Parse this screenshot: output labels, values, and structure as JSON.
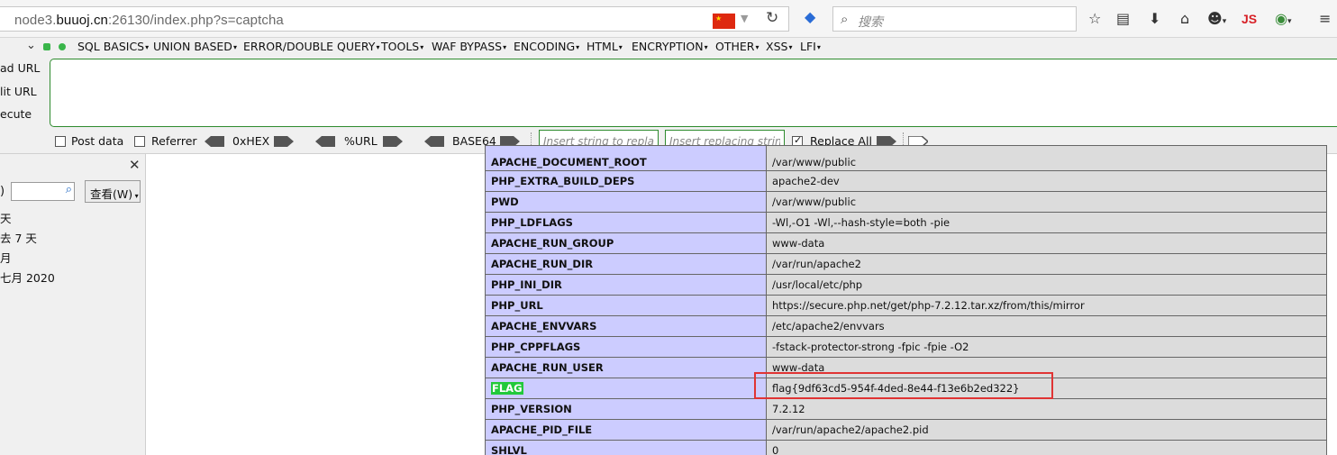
{
  "browser": {
    "info_glyph": "i",
    "url_prefix": "node3.",
    "url_domain": "buuoj.cn",
    "url_suffix": ":26130/index.php?s=captcha",
    "search_placeholder": "搜索",
    "js_label": "JS"
  },
  "hackbar": {
    "menu": [
      "SQL BASICS",
      "UNION BASED",
      "ERROR/DOUBLE QUERY",
      "TOOLS",
      "WAF BYPASS",
      "ENCODING",
      "HTML",
      "ENCRYPTION",
      "OTHER",
      "XSS",
      "LFI"
    ],
    "side_buttons": [
      "ad URL",
      "lit URL",
      "ecute"
    ],
    "options": {
      "post_data": "Post data",
      "referrer": "Referrer",
      "hex": "0xHEX",
      "url": "%URL",
      "base64": "BASE64",
      "find_placeholder": "Insert string to replace",
      "replace_placeholder": "Insert replacing string",
      "replace_all": "Replace All",
      "replace_all_checked": true,
      "post_data_checked": false,
      "referrer_checked": false
    }
  },
  "side_panel": {
    "close": "✕",
    "paren": ")",
    "view_button": "查看(W)",
    "history": [
      "天",
      "去 7 天",
      "月",
      "七月 2020"
    ]
  },
  "phpinfo": {
    "rows": [
      {
        "key": "APACHE_DOCUMENT_ROOT",
        "value": "/var/www/public"
      },
      {
        "key": "PHP_EXTRA_BUILD_DEPS",
        "value": "apache2-dev"
      },
      {
        "key": "PWD",
        "value": "/var/www/public"
      },
      {
        "key": "PHP_LDFLAGS",
        "value": "-Wl,-O1 -Wl,--hash-style=both -pie"
      },
      {
        "key": "APACHE_RUN_GROUP",
        "value": "www-data"
      },
      {
        "key": "APACHE_RUN_DIR",
        "value": "/var/run/apache2"
      },
      {
        "key": "PHP_INI_DIR",
        "value": "/usr/local/etc/php"
      },
      {
        "key": "PHP_URL",
        "value": "https://secure.php.net/get/php-7.2.12.tar.xz/from/this/mirror"
      },
      {
        "key": "APACHE_ENVVARS",
        "value": "/etc/apache2/envvars"
      },
      {
        "key": "PHP_CPPFLAGS",
        "value": "-fstack-protector-strong -fpic -fpie -O2"
      },
      {
        "key": "APACHE_RUN_USER",
        "value": "www-data"
      },
      {
        "key": "FLAG",
        "value": "flag{9df63cd5-954f-4ded-8e44-f13e6b2ed322}"
      },
      {
        "key": "PHP_VERSION",
        "value": "7.2.12"
      },
      {
        "key": "APACHE_PID_FILE",
        "value": "/var/run/apache2/apache2.pid"
      },
      {
        "key": "SHLVL",
        "value": "0"
      }
    ]
  }
}
